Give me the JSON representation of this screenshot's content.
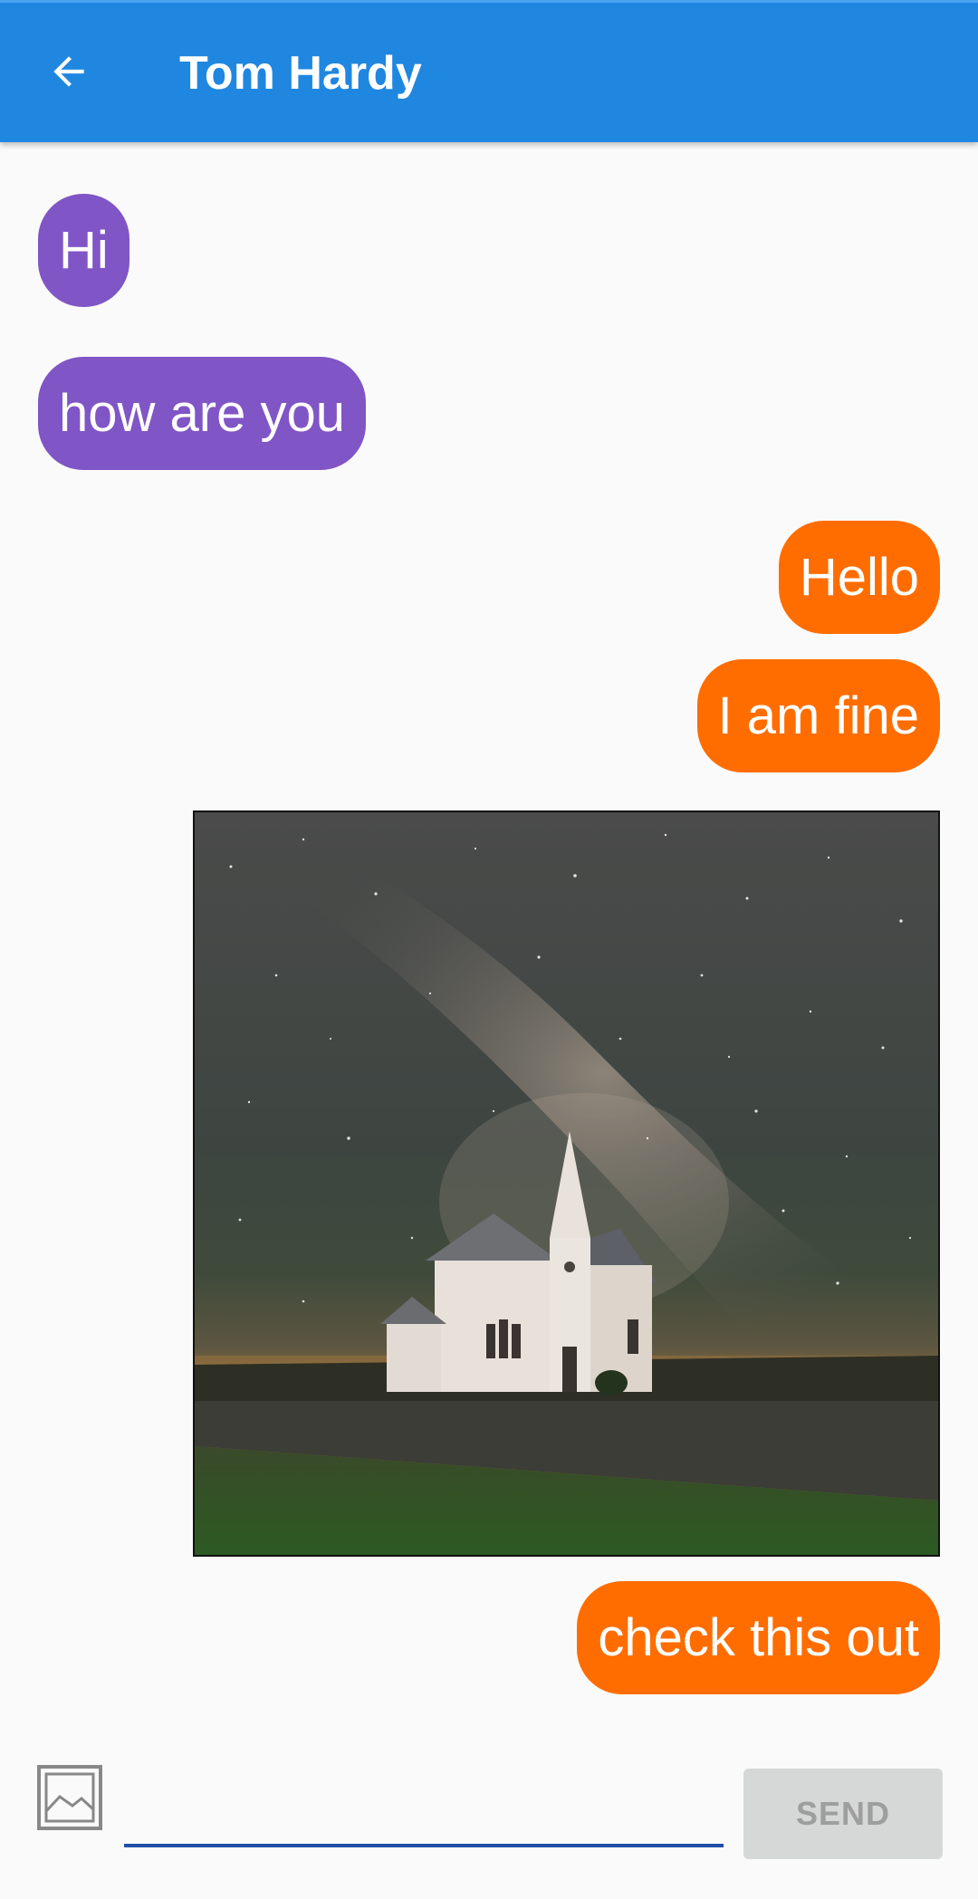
{
  "header": {
    "title": "Tom Hardy",
    "back_icon": "arrow-back-icon",
    "background_color": "#1f87e0"
  },
  "messages": [
    {
      "direction": "incoming",
      "type": "text",
      "text": "Hi"
    },
    {
      "direction": "incoming",
      "type": "text",
      "text": "how are you"
    },
    {
      "direction": "outgoing",
      "type": "text",
      "text": "Hello"
    },
    {
      "direction": "outgoing",
      "type": "text",
      "text": "I am fine"
    },
    {
      "direction": "outgoing",
      "type": "image",
      "subject": "church-under-milky-way-photo"
    },
    {
      "direction": "outgoing",
      "type": "text",
      "text": "check this out"
    }
  ],
  "colors": {
    "incoming_bubble": "#8055c6",
    "outgoing_bubble": "#ff6d00",
    "input_underline": "#1f4fa8"
  },
  "composer": {
    "attach_icon": "image-icon",
    "input_value": "",
    "send_label": "SEND",
    "send_enabled": false
  }
}
